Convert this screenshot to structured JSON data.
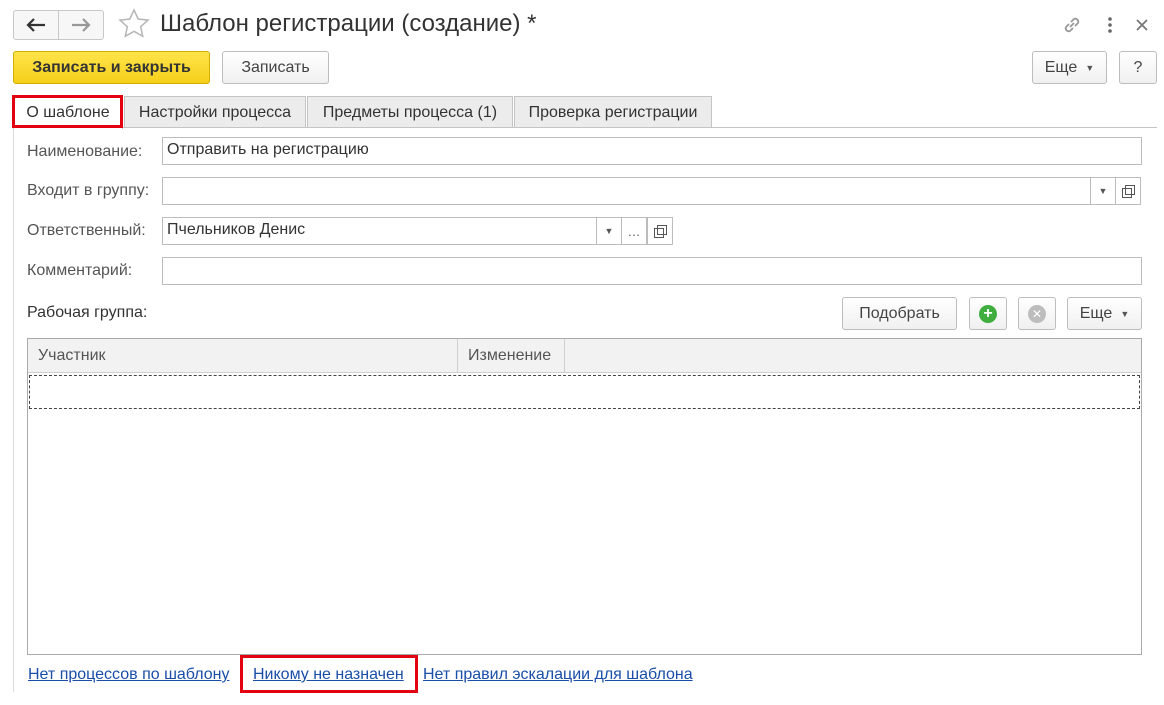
{
  "title_bar": {
    "title": "Шаблон регистрации (создание) *"
  },
  "toolbar": {
    "save_close_label": "Записать и закрыть",
    "save_label": "Записать",
    "more_label": "Еще",
    "help_label": "?"
  },
  "tabs": [
    {
      "label": "О шаблоне",
      "active": true
    },
    {
      "label": "Настройки процесса",
      "active": false
    },
    {
      "label": "Предметы процесса (1)",
      "active": false
    },
    {
      "label": "Проверка регистрации",
      "active": false
    }
  ],
  "form": {
    "name_label": "Наименование:",
    "name_value": "Отправить на регистрацию",
    "group_label": "Входит в группу:",
    "group_value": "",
    "responsible_label": "Ответственный:",
    "responsible_value": "Пчельников Денис",
    "comment_label": "Комментарий:",
    "comment_value": ""
  },
  "work_group": {
    "label": "Рабочая группа:",
    "pick_label": "Подобрать",
    "more_label": "Еще",
    "columns": [
      "Участник",
      "Изменение"
    ],
    "rows": []
  },
  "footer_links": {
    "processes": "Нет процессов по шаблону",
    "assigned": "Никому не назначен",
    "escalation": "Нет правил эскалации для шаблона"
  },
  "colors": {
    "primary_button": "#f5cf1a",
    "highlight": "#e3000f",
    "link": "#1a4ea8",
    "add_icon": "#3fae3f"
  }
}
